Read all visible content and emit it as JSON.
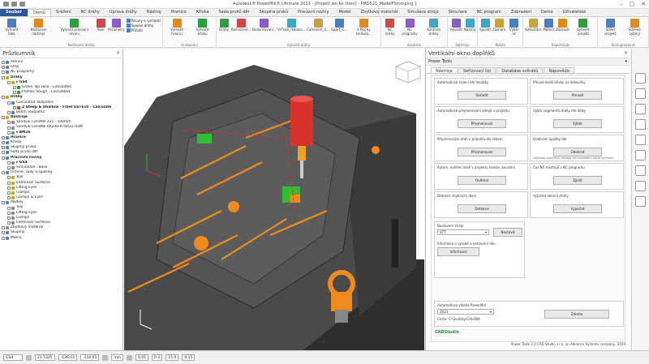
{
  "window_title": "Autodesk® PowerMill® Ultimate 2021 - [Projekt jen ke čtení] - PMD521_ModelFStomping ]",
  "tabs": [
    "Soubor",
    "Domů",
    "Srážení",
    "NC dráhy",
    "Úprava dráhy",
    "Nástroj",
    "Hranice",
    "Křivka",
    "Sada prvků děr",
    "Skupina prvků",
    "Pracovní roviny",
    "Model",
    "Zbytkový materiál",
    "Simulace stroje",
    "Simulace",
    "NC program",
    "Zobrazení",
    "Demo",
    "Uživatelské"
  ],
  "active_tab": "Domů",
  "ribbon": {
    "groups": [
      {
        "label": "Nastavení dráhy",
        "buttons": [
          "Vytvořit blok",
          "Nastavení nástroje",
          "Vytvořit pracovní rovinu",
          "Blok",
          "Parametry"
        ],
        "small": [
          "Posuny a rychlosti",
          "Spojení dráhy",
          "Přičíslit"
        ]
      },
      {
        "label": "Hrubování",
        "buttons": [
          "Vytvořit hranici",
          "Vytvořit křivku"
        ]
      },
      {
        "label": "Vytvořit dráhy",
        "buttons": [
          "Dráhy",
          "Bočnicové...",
          "Dokončování...",
          "VrTiam_dokonc...",
          "Comment_C...",
          "Swarf_C...",
          "3 Plochy konturo..."
        ]
      },
      {
        "label": "Kontrola",
        "buttons": [
          "NC dráhy",
          "NC programy",
          "Kontrola dráhy"
        ]
      },
      {
        "label": "Nástroje",
        "buttons": [
          "Vytvořit",
          "Nástroj"
        ]
      },
      {
        "label": "Makro",
        "buttons": [
          "Spustit",
          "Záznam",
          "Výběr nc"
        ]
      },
      {
        "label": "Exportovat",
        "buttons": [
          "Kalkulátor",
          "Měření",
          "Zobrazit",
          "Vytvořit projekt"
        ]
      },
      {
        "label": "Spolupracovat",
        "buttons": [
          "Sdílet projekt",
          "Sdílené výběry"
        ]
      }
    ]
  },
  "left_panel": {
    "title": "Průzkumník",
    "tree": [
      {
        "label": "Aktivní",
        "level": 0,
        "color": "#4a7fc1"
      },
      {
        "label": "Stroj",
        "level": 0,
        "color": "#7a7a7a"
      },
      {
        "label": "NC programy",
        "level": 0,
        "color": "#4a7fc1"
      },
      {
        "label": "Dráhy",
        "level": 0,
        "color": "#d8a000",
        "bold": true
      },
      {
        "label": "▸ GS4",
        "level": 1,
        "color": "#d8a000",
        "bold": true
      },
      {
        "label": "Green Top Face - Calculated",
        "level": 2,
        "color": "#2e9a2e"
      },
      {
        "label": "Profiles Rough - Calculated",
        "level": 2,
        "color": "#2e9a2e"
      },
      {
        "label": "Dráhy",
        "level": 0,
        "color": "#d8a000",
        "bold": true
      },
      {
        "label": "Calculated Toolpaths",
        "level": 1,
        "color": "#4a7fc1"
      },
      {
        "label": "3 Steep & Shallow - Fillet ESTE10 - Calculate",
        "level": 2,
        "color": "#d04020",
        "bold": true
      },
      {
        "label": "Batch Toolpaths",
        "level": 1,
        "color": "#4a7fc1"
      },
      {
        "label": "Nástroje",
        "level": 0,
        "color": "#d8a000",
        "bold": true
      },
      {
        "label": "Sandvik CoroMill 221 - 100mm",
        "level": 1,
        "color": "#888"
      },
      {
        "label": "Sandvik CoroMill RA200-076R22-43M",
        "level": 1,
        "color": "#888"
      },
      {
        "label": "▸ BM16",
        "level": 1,
        "color": "#888",
        "bold": true
      },
      {
        "label": "Hranice",
        "level": 0,
        "color": "#4a7fc1",
        "bold": true
      },
      {
        "label": "Křivky",
        "level": 0,
        "color": "#4a7fc1"
      },
      {
        "label": "Skupiny prvků",
        "level": 0,
        "color": "#4a7fc1"
      },
      {
        "label": "Sady prvků děr",
        "level": 0,
        "color": "#4a7fc1"
      },
      {
        "label": "Pracovní roviny",
        "level": 0,
        "color": "#4a7fc1",
        "bold": true
      },
      {
        "label": "▸ GS4",
        "level": 1,
        "color": "#888",
        "bold": true
      },
      {
        "label": "Simulation - Base",
        "level": 1,
        "color": "#888"
      },
      {
        "label": "Úrovně, sady a sputnky",
        "level": 0,
        "color": "#4a7fc1"
      },
      {
        "label": "Tool",
        "level": 1,
        "color": "#d8a000"
      },
      {
        "label": "Extension Surfaces",
        "level": 1,
        "color": "#d8a000"
      },
      {
        "label": "Lifting Eyes",
        "level": 1,
        "color": "#d8a000"
      },
      {
        "label": "Clamps",
        "level": 1,
        "color": "#d8a000"
      },
      {
        "label": "Clamps & Eyes",
        "level": 1,
        "color": "#d8a000"
      },
      {
        "label": "Modely",
        "level": 0,
        "color": "#4a7fc1"
      },
      {
        "label": "Tool",
        "level": 1,
        "color": "#888"
      },
      {
        "label": "Lifting Eyes",
        "level": 1,
        "color": "#888"
      },
      {
        "label": "Clamps",
        "level": 1,
        "color": "#888"
      },
      {
        "label": "Extension Surfaces",
        "level": 1,
        "color": "#888"
      },
      {
        "label": "Zbytkový materiál",
        "level": 0,
        "color": "#888"
      },
      {
        "label": "Skupiny",
        "level": 0,
        "color": "#4a7fc1"
      },
      {
        "label": "Makra",
        "level": 0,
        "color": "#4a7fc1"
      }
    ]
  },
  "right_panel": {
    "title": "Vertikální okno doplňků",
    "subtitle": "Power Tools",
    "tabs": [
      "Nástroje",
      "Seřizovací list",
      "Databáze svěráků",
      "Nápověda"
    ],
    "active_tab": "Nástroje",
    "cells": [
      {
        "label": "Automatická řazení dle hloubky",
        "button": "Seřadit"
      },
      {
        "label": "Převod bodů křivky na dokoušky",
        "button": "Převod"
      },
      {
        "label": "Automatické přejmenování zdrojů v projektu",
        "button": "Přejmenovat"
      },
      {
        "label": "Výběr segmentů dráhy dle délky",
        "button": "Výběr"
      },
      {
        "label": "Přejmenování drah v projektu dle řádem",
        "button": "Přejmenovat"
      },
      {
        "label": "Odebrání úpožky dle",
        "button": "Odebrat"
      },
      {
        "label": "Autom. ověření drah v projektu (kolize, bourání)",
        "button": "Ověření"
      },
      {
        "label": "Čas NC-nástrojů v NC programu",
        "button": "Zjistit"
      },
      {
        "label": "Detekce chybných dlaní",
        "button": "Detekce"
      },
      {
        "label": "Výpočet aktivní dráhy",
        "button": "Vypočet"
      }
    ],
    "hint_text": "Vyhledat ukončená nástroje bez provedení kolize (vyhneš)",
    "nastaveni": {
      "label": "Nastavení stroje",
      "value": "STT",
      "button": "Nastavit"
    },
    "info_label": "Informace o výrobě a sestavení dílu",
    "info_button": "Informace",
    "zaloha": {
      "label": "Automatická záloha PowerMill",
      "value": "2021",
      "path_label": "Cesta: C:\\Svatsky\\CALONA",
      "button": "Záloha"
    },
    "logo_text": "CADStudio",
    "footer": "Power Tools 2.0 CAD Studio s.r.o. an Advance Systems company, 2020"
  },
  "status_bar": {
    "items": [
      "GS4",
      "21.5325",
      "-136.03",
      "-110.01",
      "mm",
      "0.01",
      "0.2",
      "15.0",
      "0.15"
    ]
  },
  "colors": {
    "accent": "#2b5797",
    "model_dark": "#3c3c3c",
    "orange": "#f08a1c",
    "green": "#2fbf2f",
    "tool_red": "#d9322c"
  }
}
